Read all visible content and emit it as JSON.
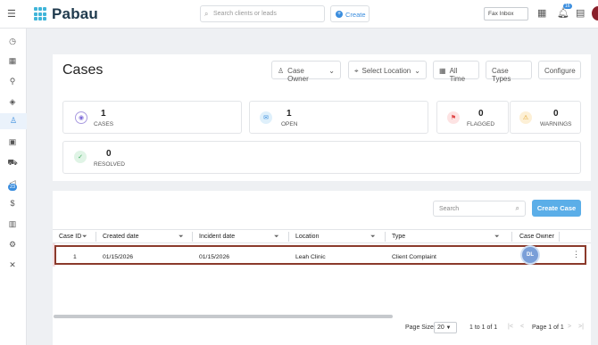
{
  "app": {
    "brand": "Pabau"
  },
  "topbar": {
    "search_placeholder": "Search clients or leads",
    "create_label": "Create",
    "fax_label": "Fax Inbox",
    "notif_count": "16"
  },
  "sidebar": {
    "badge": "23"
  },
  "page": {
    "title": "Cases",
    "filters": {
      "case_owner": "Case Owner",
      "location": "Select Location",
      "time": "All Time",
      "case_types": "Case Types",
      "configure": "Configure"
    }
  },
  "stats": [
    {
      "value": "1",
      "label": "CASES"
    },
    {
      "value": "1",
      "label": "OPEN"
    },
    {
      "value": "0",
      "label": "FLAGGED"
    },
    {
      "value": "0",
      "label": "WARNINGS"
    },
    {
      "value": "0",
      "label": "RESOLVED"
    }
  ],
  "table": {
    "search_placeholder": "Search",
    "create_label": "Create Case",
    "columns": [
      "Case ID",
      "Created date",
      "Incident date",
      "Location",
      "Type",
      "Case Owner"
    ],
    "rows": [
      {
        "case_id": "1",
        "created": "01/15/2026",
        "incident": "01/15/2026",
        "location": "Leah Clinic",
        "type": "Client Complaint",
        "owner": "DL"
      }
    ],
    "pager": {
      "page_size_label": "Page Size:",
      "page_size": "20",
      "range": "1 to 1 of 1",
      "page": "Page 1 of 1"
    }
  }
}
